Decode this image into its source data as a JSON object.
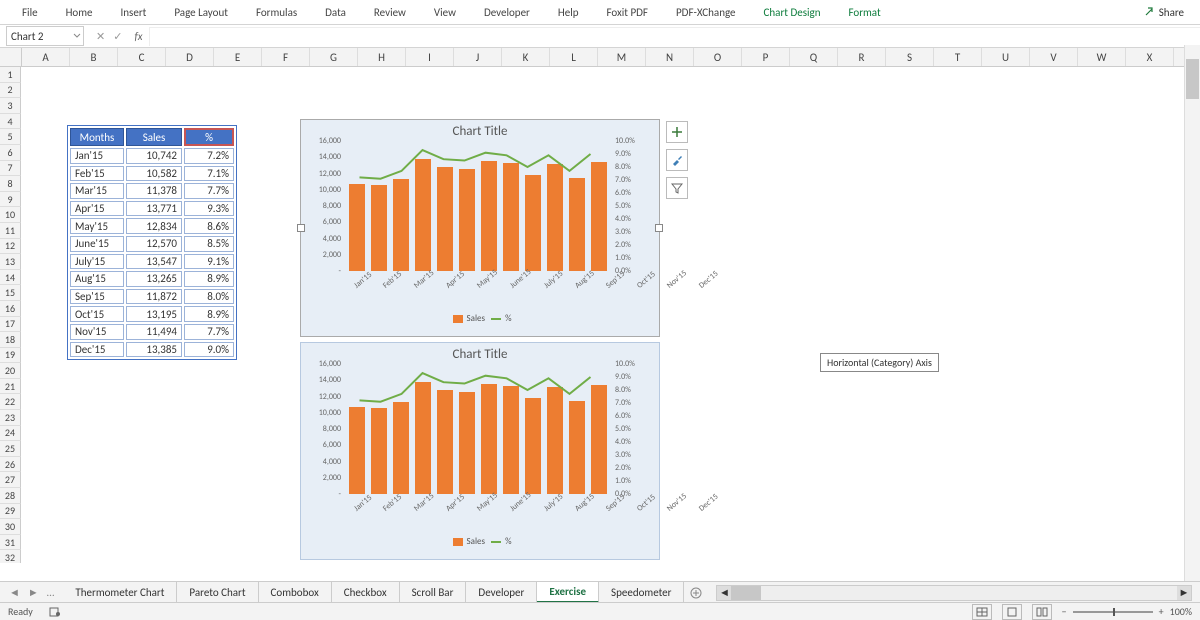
{
  "ribbon": {
    "tabs": [
      "File",
      "Home",
      "Insert",
      "Page Layout",
      "Formulas",
      "Data",
      "Review",
      "View",
      "Developer",
      "Help",
      "Foxit PDF",
      "PDF-XChange"
    ],
    "ctx_tabs": [
      "Chart Design",
      "Format"
    ],
    "share": "Share"
  },
  "fxbar": {
    "namebox": "Chart 2",
    "fx": "fx"
  },
  "columns": [
    "A",
    "B",
    "C",
    "D",
    "E",
    "F",
    "G",
    "H",
    "I",
    "J",
    "K",
    "L",
    "M",
    "N",
    "O",
    "P",
    "Q",
    "R",
    "S",
    "T",
    "U",
    "V",
    "W",
    "X"
  ],
  "row_count": 34,
  "table": {
    "headers": [
      "Months",
      "Sales",
      "%"
    ],
    "rows": [
      {
        "m": "Jan'15",
        "s": "10,742",
        "p": "7.2%"
      },
      {
        "m": "Feb'15",
        "s": "10,582",
        "p": "7.1%"
      },
      {
        "m": "Mar'15",
        "s": "11,378",
        "p": "7.7%"
      },
      {
        "m": "Apr'15",
        "s": "13,771",
        "p": "9.3%"
      },
      {
        "m": "May'15",
        "s": "12,834",
        "p": "8.6%"
      },
      {
        "m": "June'15",
        "s": "12,570",
        "p": "8.5%"
      },
      {
        "m": "July'15",
        "s": "13,547",
        "p": "9.1%"
      },
      {
        "m": "Aug'15",
        "s": "13,265",
        "p": "8.9%"
      },
      {
        "m": "Sep'15",
        "s": "11,872",
        "p": "8.0%"
      },
      {
        "m": "Oct'15",
        "s": "13,195",
        "p": "8.9%"
      },
      {
        "m": "Nov'15",
        "s": "11,494",
        "p": "7.7%"
      },
      {
        "m": "Dec'15",
        "s": "13,385",
        "p": "9.0%"
      }
    ]
  },
  "chart_data": [
    {
      "type": "bar-line-combo",
      "title": "Chart Title",
      "categories": [
        "Jan'15",
        "Feb'15",
        "Mar'15",
        "Apr'15",
        "May'15",
        "June'15",
        "July'15",
        "Aug'15",
        "Sep'15",
        "Oct'15",
        "Nov'15",
        "Dec'15"
      ],
      "series": [
        {
          "name": "Sales",
          "type": "bar",
          "axis": "primary",
          "values": [
            10742,
            10582,
            11378,
            13771,
            12834,
            12570,
            13547,
            13265,
            11872,
            13195,
            11494,
            13385
          ]
        },
        {
          "name": "%",
          "type": "line",
          "axis": "secondary",
          "values": [
            7.2,
            7.1,
            7.7,
            9.3,
            8.6,
            8.5,
            9.1,
            8.9,
            8.0,
            8.9,
            7.7,
            9.0
          ]
        }
      ],
      "ylim": [
        0,
        16000
      ],
      "yticks": [
        "-",
        "2,000",
        "4,000",
        "6,000",
        "8,000",
        "10,000",
        "12,000",
        "14,000",
        "16,000"
      ],
      "y2lim": [
        0,
        10
      ],
      "y2ticks": [
        "0.0%",
        "1.0%",
        "2.0%",
        "3.0%",
        "4.0%",
        "5.0%",
        "6.0%",
        "7.0%",
        "8.0%",
        "9.0%",
        "10.0%"
      ],
      "legend": [
        "Sales",
        "%"
      ]
    },
    {
      "type": "bar-line-combo",
      "title": "Chart Title",
      "categories": [
        "Jan'15",
        "Feb'15",
        "Mar'15",
        "Apr'15",
        "May'15",
        "June'15",
        "July'15",
        "Aug'15",
        "Sep'15",
        "Oct'15",
        "Nov'15",
        "Dec'15"
      ],
      "series": [
        {
          "name": "Sales",
          "type": "bar",
          "axis": "primary",
          "values": [
            10742,
            10582,
            11378,
            13771,
            12834,
            12570,
            13547,
            13265,
            11872,
            13195,
            11494,
            13385
          ]
        },
        {
          "name": "%",
          "type": "line",
          "axis": "secondary",
          "values": [
            7.2,
            7.1,
            7.7,
            9.3,
            8.6,
            8.5,
            9.1,
            8.9,
            8.0,
            8.9,
            7.7,
            9.0
          ]
        }
      ],
      "ylim": [
        0,
        16000
      ],
      "yticks": [
        "-",
        "2,000",
        "4,000",
        "6,000",
        "8,000",
        "10,000",
        "12,000",
        "14,000",
        "16,000"
      ],
      "y2lim": [
        0,
        10
      ],
      "y2ticks": [
        "0.0%",
        "1.0%",
        "2.0%",
        "3.0%",
        "4.0%",
        "5.0%",
        "6.0%",
        "7.0%",
        "8.0%",
        "9.0%",
        "10.0%"
      ],
      "legend": [
        "Sales",
        "%"
      ]
    }
  ],
  "tooltip": "Horizontal (Category) Axis",
  "sheet_tabs": [
    "Thermometer Chart",
    "Pareto Chart",
    "Combobox",
    "Checkbox",
    "Scroll Bar",
    "Developer",
    "Exercise",
    "Speedometer"
  ],
  "active_sheet": "Exercise",
  "status": {
    "left": "Ready",
    "zoom": "100%"
  },
  "colors": {
    "bar": "#ed7d31",
    "line": "#70ad47",
    "header": "#4472c4"
  }
}
